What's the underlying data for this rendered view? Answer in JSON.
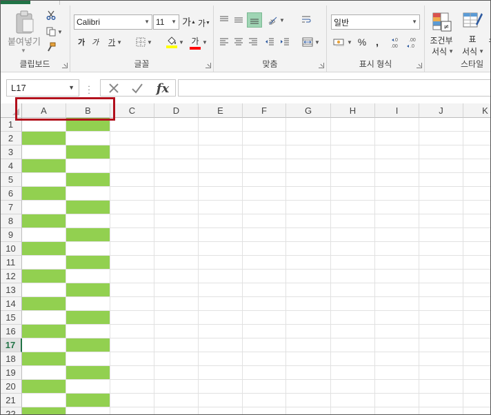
{
  "ribbon": {
    "clipboard": {
      "paste_label": "붙여넣기",
      "group_label": "클립보드"
    },
    "font": {
      "font_name": "Calibri",
      "font_size": "11",
      "grow_label": "가",
      "shrink_label": "가",
      "bold_label": "가",
      "italic_label": "가",
      "underline_label": "가",
      "font_color_label": "가",
      "font_color": "#ff0000",
      "fill_color": "#ffff00",
      "group_label": "글꼴"
    },
    "alignment": {
      "group_label": "맞춤"
    },
    "number": {
      "format_value": "일반",
      "percent_label": "%",
      "comma_label": ",",
      "group_label": "표시 형식"
    },
    "styles": {
      "conditional_label_1": "조건부",
      "conditional_label_2": "서식",
      "table_label_1": "표",
      "table_label_2": "서식",
      "cell_label_1": "스",
      "group_label": "스타일"
    }
  },
  "formula_bar": {
    "name_box": "L17",
    "fx_label": "fx",
    "formula": ""
  },
  "grid": {
    "columns": [
      "A",
      "B",
      "C",
      "D",
      "E",
      "F",
      "G",
      "H",
      "I",
      "J",
      "K"
    ],
    "rows": [
      "1",
      "2",
      "3",
      "4",
      "5",
      "6",
      "7",
      "8",
      "9",
      "10",
      "11",
      "12",
      "13",
      "14",
      "15",
      "16",
      "17",
      "18",
      "19",
      "20",
      "21",
      "22"
    ],
    "active_row": "17",
    "fill_color": "#92d050",
    "highlight_color": "#b20f1c",
    "pattern": "A filled on even rows, B filled on odd rows"
  }
}
